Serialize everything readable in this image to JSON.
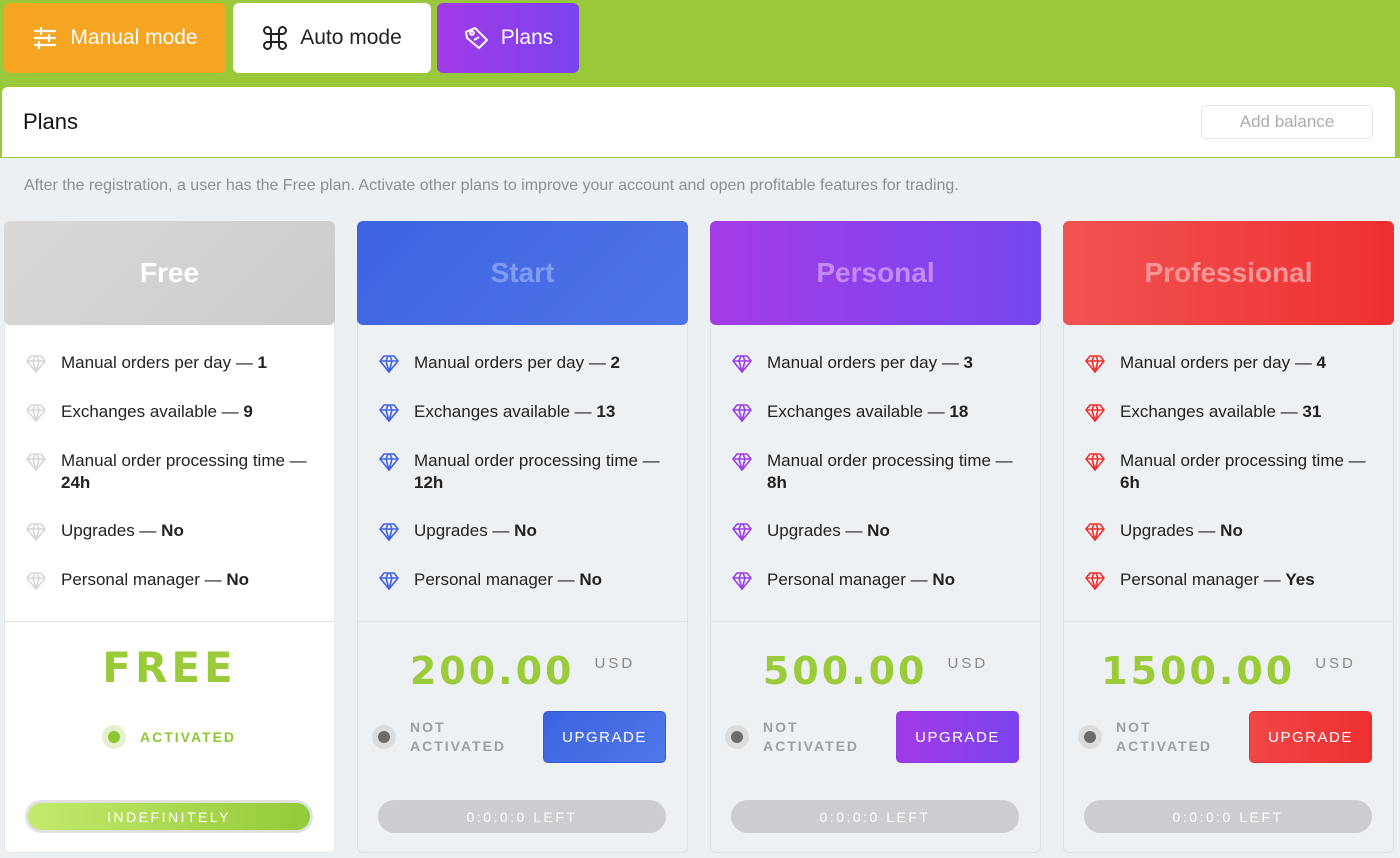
{
  "tabs": {
    "manual": "Manual mode",
    "auto": "Auto mode",
    "plans": "Plans"
  },
  "header": {
    "title": "Plans",
    "add_balance": "Add balance"
  },
  "description": "After the registration, a user has the Free plan. Activate other plans to improve your account and open profitable features for trading.",
  "colors": {
    "topbar": "#99c93b",
    "free": "#cfcfcf",
    "start": "#4468e4",
    "personal": "#8e40ea",
    "professional": "#f04040",
    "price": "#9acb38"
  },
  "plans": [
    {
      "name": "Free",
      "features": [
        {
          "label": "Manual orders per day — ",
          "value": "1"
        },
        {
          "label": "Exchanges available — ",
          "value": "9"
        },
        {
          "label": "Manual order processing time — ",
          "value": "24h"
        },
        {
          "label": "Upgrades — ",
          "value": "No"
        },
        {
          "label": "Personal manager — ",
          "value": "No"
        }
      ],
      "price": "FREE",
      "status": "ACTIVATED",
      "period": "INDEFINITELY"
    },
    {
      "name": "Start",
      "features": [
        {
          "label": "Manual orders per day — ",
          "value": "2"
        },
        {
          "label": "Exchanges available — ",
          "value": "13"
        },
        {
          "label": "Manual order processing time — ",
          "value": "12h"
        },
        {
          "label": "Upgrades — ",
          "value": "No"
        },
        {
          "label": "Personal manager — ",
          "value": "No"
        }
      ],
      "price": "200.00",
      "currency": "USD",
      "status_line1": "NOT",
      "status_line2": "ACTIVATED",
      "button": "UPGRADE",
      "time_left": "0:0:0:0 LEFT"
    },
    {
      "name": "Personal",
      "features": [
        {
          "label": "Manual orders per day — ",
          "value": "3"
        },
        {
          "label": "Exchanges available — ",
          "value": "18"
        },
        {
          "label": "Manual order processing time — ",
          "value": "8h"
        },
        {
          "label": "Upgrades — ",
          "value": "No"
        },
        {
          "label": "Personal manager — ",
          "value": "No"
        }
      ],
      "price": "500.00",
      "currency": "USD",
      "status_line1": "NOT",
      "status_line2": "ACTIVATED",
      "button": "UPGRADE",
      "time_left": "0:0:0:0 LEFT"
    },
    {
      "name": "Professional",
      "features": [
        {
          "label": "Manual orders per day — ",
          "value": "4"
        },
        {
          "label": "Exchanges available — ",
          "value": "31"
        },
        {
          "label": "Manual order processing time — ",
          "value": "6h"
        },
        {
          "label": "Upgrades — ",
          "value": "No"
        },
        {
          "label": "Personal manager — ",
          "value": "Yes"
        }
      ],
      "price": "1500.00",
      "currency": "USD",
      "status_line1": "NOT",
      "status_line2": "ACTIVATED",
      "button": "UPGRADE",
      "time_left": "0:0:0:0 LEFT"
    }
  ]
}
